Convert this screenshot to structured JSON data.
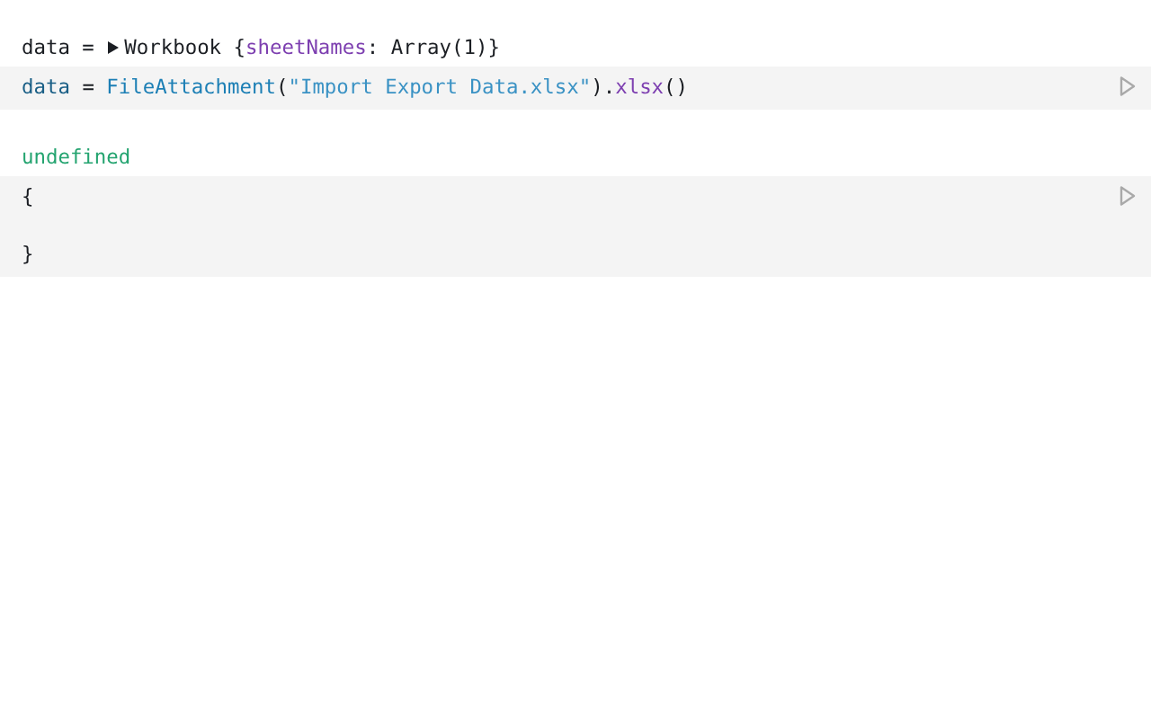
{
  "cells": [
    {
      "output": {
        "expanded": false,
        "tokens": [
          {
            "kind": "plain",
            "t": "data = "
          },
          {
            "kind": "toggle"
          },
          {
            "kind": "plain",
            "t": "Workbook {"
          },
          {
            "kind": "key",
            "t": "sheetNames"
          },
          {
            "kind": "plain",
            "t": ": Array(1)}"
          }
        ]
      },
      "code": {
        "lines": [
          [
            {
              "kind": "var",
              "t": "data"
            },
            {
              "kind": "plain",
              "t": " = "
            },
            {
              "kind": "fn",
              "t": "FileAttachment"
            },
            {
              "kind": "plain",
              "t": "("
            },
            {
              "kind": "string",
              "t": "\"Import Export Data.xlsx\""
            },
            {
              "kind": "plain",
              "t": ")."
            },
            {
              "kind": "method",
              "t": "xlsx"
            },
            {
              "kind": "plain",
              "t": "()"
            }
          ]
        ]
      }
    },
    {
      "output": {
        "tokens": [
          {
            "kind": "undefined",
            "t": "undefined"
          }
        ]
      },
      "code": {
        "lines": [
          [
            {
              "kind": "plain",
              "t": "{"
            }
          ],
          [
            {
              "kind": "plain",
              "t": "}"
            }
          ]
        ]
      }
    }
  ]
}
